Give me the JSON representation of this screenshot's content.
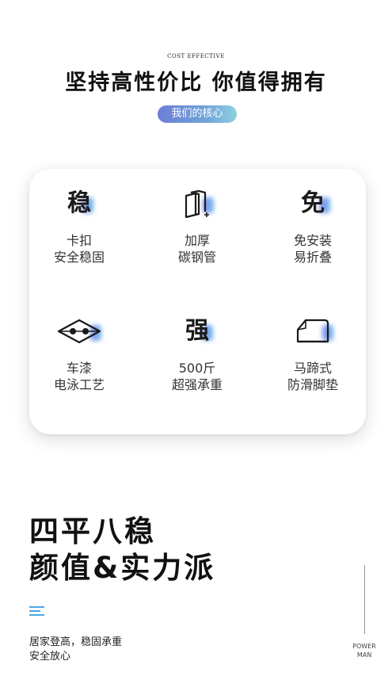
{
  "header": {
    "eyebrow": "COST EFFECTIVE",
    "headline": "坚持高性价比 你值得拥有",
    "pill_label": "我们的核心"
  },
  "features": [
    {
      "icon": "wen-character-icon",
      "glyph": "稳",
      "line1": "卡扣",
      "line2": "安全稳固"
    },
    {
      "icon": "layered-steel-tube-icon",
      "line1": "加厚",
      "line2": "碳钢管"
    },
    {
      "icon": "mian-character-icon",
      "glyph": "免",
      "line1": "免安装",
      "line2": "易折叠"
    },
    {
      "icon": "diamond-eye-icon",
      "line1": "车漆",
      "line2": "电泳工艺"
    },
    {
      "icon": "qiang-character-icon",
      "glyph": "强",
      "line1": "500斤",
      "line2": "超强承重"
    },
    {
      "icon": "foot-pad-icon",
      "line1": "马蹄式",
      "line2": "防滑脚垫"
    }
  ],
  "bottom": {
    "title_line1": "四平八稳",
    "title_line2": "颜值&实力派",
    "tagline_line1": "居家登高，稳固承重",
    "tagline_line2": "安全放心",
    "brand_line1": "POWER",
    "brand_line2": "MAN"
  },
  "colors": {
    "accent_gradient_start": "#6d7fd6",
    "accent_gradient_end": "#8fd0de",
    "icon_highlight": "#5cb2e8"
  }
}
